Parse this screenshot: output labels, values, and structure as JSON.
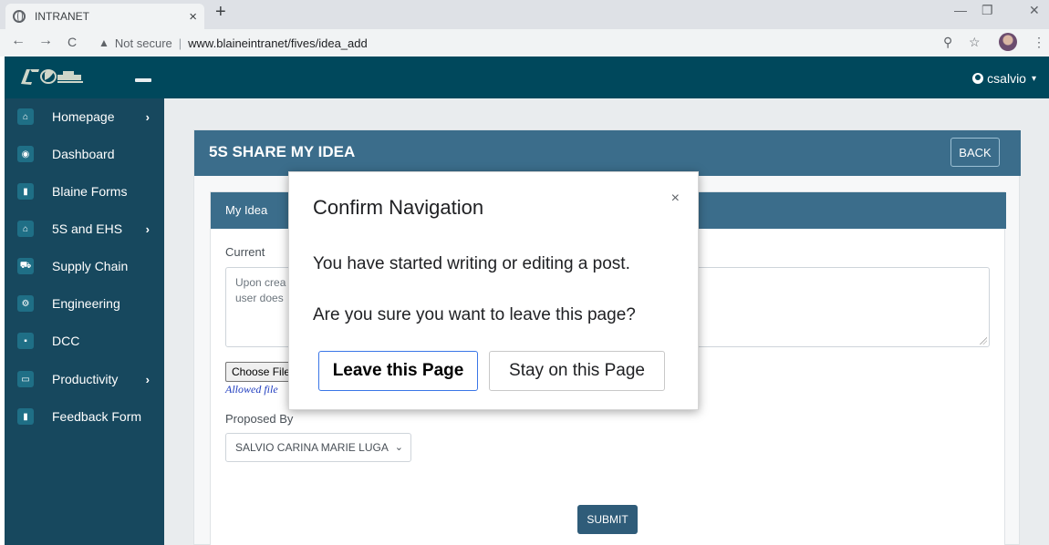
{
  "browser": {
    "tab_title": "INTRANET",
    "tab_close": "×",
    "new_tab": "+",
    "minimize": "—",
    "restore": "❐",
    "close": "✕",
    "back": "←",
    "forward": "→",
    "reload": "C",
    "not_secure": "Not secure",
    "url": "www.blaineintranet/fives/idea_add",
    "zoom_icon": "⚲",
    "star_icon": "☆",
    "menu_icon": "⋮"
  },
  "topnav": {
    "username": "csalvio",
    "caret": "▾"
  },
  "sidebar": {
    "items": [
      {
        "label": "Homepage",
        "icon": "⌂",
        "arrow": "›"
      },
      {
        "label": "Dashboard",
        "icon": "◉",
        "arrow": ""
      },
      {
        "label": "Blaine Forms",
        "icon": "▮",
        "arrow": ""
      },
      {
        "label": "5S and EHS",
        "icon": "⌂",
        "arrow": "›"
      },
      {
        "label": "Supply Chain",
        "icon": "⛟",
        "arrow": ""
      },
      {
        "label": "Engineering",
        "icon": "⚙",
        "arrow": ""
      },
      {
        "label": "DCC",
        "icon": "▪",
        "arrow": ""
      },
      {
        "label": "Productivity",
        "icon": "▭",
        "arrow": "›"
      },
      {
        "label": "Feedback Form",
        "icon": "▮",
        "arrow": ""
      }
    ]
  },
  "card": {
    "title": "5S SHARE MY IDEA",
    "back_label": "BACK"
  },
  "form": {
    "section_title": "My Idea",
    "current_label": "Current",
    "current_value_line1": "Upon crea",
    "current_value_line2": "user does",
    "choose_file": "Choose File",
    "allowed_file": "Allowed file",
    "proposed_by_label": "Proposed By",
    "proposed_by_value": "SALVIO CARINA MARIE LUGA",
    "select_chevron": "⌄",
    "submit_label": "SUBMIT"
  },
  "dialog": {
    "title": "Confirm Navigation",
    "close": "×",
    "message1": "You have started writing or editing a post.",
    "message2": "Are you sure you want to leave this page?",
    "leave_label": "Leave this Page",
    "stay_label": "Stay on this Page"
  }
}
